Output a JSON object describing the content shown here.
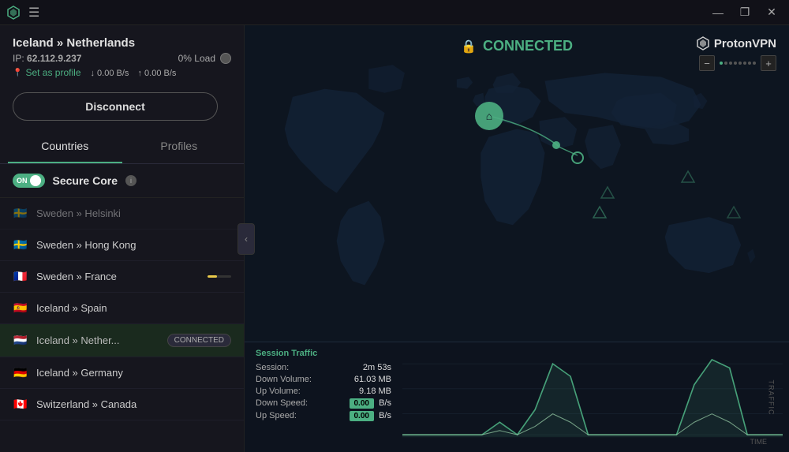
{
  "titleBar": {
    "minimize": "—",
    "maximize": "❐",
    "close": "✕"
  },
  "leftPanel": {
    "connectionTitle": "Iceland » Netherlands",
    "ipLabel": "IP:",
    "ipValue": "62.112.9.237",
    "loadLabel": "0% Load",
    "downloadSpeed": "↓ 0.00 B/s",
    "uploadSpeed": "↑ 0.00 B/s",
    "setProfileLabel": "Set as profile",
    "disconnectLabel": "Disconnect",
    "tabs": {
      "countries": "Countries",
      "profiles": "Profiles"
    },
    "secureCore": {
      "toggleLabel": "ON",
      "label": "Secure Core",
      "infoLabel": "i"
    },
    "servers": [
      {
        "flag": "🇸🇪",
        "name": "Sweden » Hong Kong",
        "connected": false
      },
      {
        "flag": "🇫🇷",
        "name": "Sweden » France",
        "connected": false
      },
      {
        "flag": "🇪🇸",
        "name": "Iceland » Spain",
        "connected": false
      },
      {
        "flag": "🇳🇱",
        "name": "Iceland » Nether...",
        "connected": true
      },
      {
        "flag": "🇩🇪",
        "name": "Iceland » Germany",
        "connected": false
      },
      {
        "flag": "🇨🇦",
        "name": "Switzerland » Canada",
        "connected": false
      }
    ]
  },
  "rightPanel": {
    "connectedLabel": "CONNECTED",
    "protonLabel": "ProtonVPN",
    "zoomMinus": "−",
    "zoomPlus": "+",
    "trafficPanel": {
      "title": "Session Traffic",
      "sessionLabel": "Session:",
      "sessionValue": "2m 53s",
      "downVolumeLabel": "Down Volume:",
      "downVolumeValue": "61.03   MB",
      "upVolumeLabel": "Up Volume:",
      "upVolumeValue": "9.18   MB",
      "downSpeedLabel": "Down Speed:",
      "downSpeedValue": "0.00",
      "downSpeedUnit": "B/s",
      "upSpeedLabel": "Up Speed:",
      "upSpeedValue": "0.00",
      "upSpeedUnit": "B/s",
      "timeLabel": "TIME",
      "trafficLabel": "TRAFFIC"
    }
  }
}
